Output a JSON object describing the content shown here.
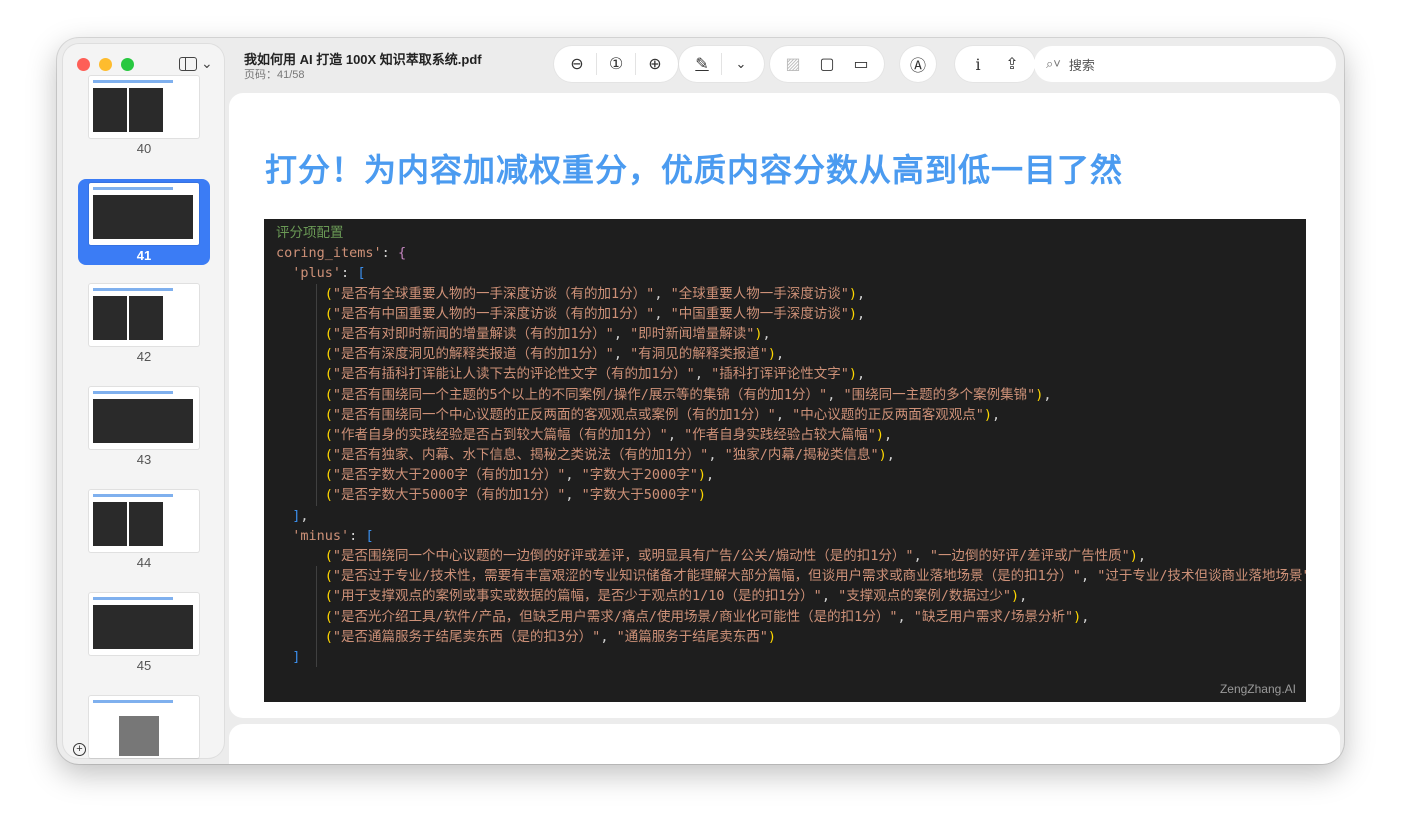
{
  "window": {
    "title": "我如何用 AI 打造 100X 知识萃取系统.pdf",
    "page_indicator": "页码：41/58"
  },
  "toolbar": {
    "search_placeholder": "搜索"
  },
  "sidebar": {
    "thumbnails": [
      {
        "page": "40"
      },
      {
        "page": "41",
        "selected": true
      },
      {
        "page": "42"
      },
      {
        "page": "43"
      },
      {
        "page": "44"
      },
      {
        "page": "45"
      }
    ]
  },
  "document": {
    "heading": "打分！为内容加减权重分，优质内容分数从高到低一目了然",
    "code": {
      "comment": "评分项配置",
      "root_key": "coring_items'",
      "plus_key": "'plus'",
      "minus_key": "'minus'",
      "plus": [
        {
          "a": "\"是否有全球重要人物的一手深度访谈（有的加1分）\"",
          "b": "\"全球重要人物一手深度访谈\"",
          "end": ","
        },
        {
          "a": "\"是否有中国重要人物的一手深度访谈（有的加1分）\"",
          "b": "\"中国重要人物一手深度访谈\"",
          "end": ","
        },
        {
          "a": "\"是否有对即时新闻的增量解读（有的加1分）\"",
          "b": "\"即时新闻增量解读\"",
          "end": ","
        },
        {
          "a": "\"是否有深度洞见的解释类报道（有的加1分）\"",
          "b": "\"有洞见的解释类报道\"",
          "end": ","
        },
        {
          "a": "\"是否有插科打诨能让人读下去的评论性文字（有的加1分）\"",
          "b": "\"插科打诨评论性文字\"",
          "end": ","
        },
        {
          "a": "\"是否有围绕同一个主题的5个以上的不同案例/操作/展示等的集锦（有的加1分）\"",
          "b": "\"围绕同一主题的多个案例集锦\"",
          "end": ","
        },
        {
          "a": "\"是否有围绕同一个中心议题的正反两面的客观观点或案例（有的加1分）\"",
          "b": "\"中心议题的正反两面客观观点\"",
          "end": ","
        },
        {
          "a": "\"作者自身的实践经验是否占到较大篇幅（有的加1分）\"",
          "b": "\"作者自身实践经验占较大篇幅\"",
          "end": ","
        },
        {
          "a": "\"是否有独家、内幕、水下信息、揭秘之类说法（有的加1分）\"",
          "b": "\"独家/内幕/揭秘类信息\"",
          "end": ","
        },
        {
          "a": "\"是否字数大于2000字（有的加1分）\"",
          "b": "\"字数大于2000字\"",
          "end": ","
        },
        {
          "a": "\"是否字数大于5000字（有的加1分）\"",
          "b": "\"字数大于5000字\"",
          "end": ""
        }
      ],
      "minus": [
        {
          "a": "\"是否围绕同一个中心议题的一边倒的好评或差评，或明显具有广告/公关/煽动性（是的扣1分）\"",
          "b": "\"一边倒的好评/差评或广告性质\"",
          "end": ","
        },
        {
          "a": "\"是否过于专业/技术性，需要有丰富艰涩的专业知识储备才能理解大部分篇幅，但谈用户需求或商业落地场景（是的扣1分）\"",
          "b": "\"过于专业/技术但谈商业落地场景\"",
          "end": ","
        },
        {
          "a": "\"用于支撑观点的案例或事实或数据的篇幅，是否少于观点的1/10（是的扣1分）\"",
          "b": "\"支撑观点的案例/数据过少\"",
          "end": ","
        },
        {
          "a": "\"是否光介绍工具/软件/产品，但缺乏用户需求/痛点/使用场景/商业化可能性（是的扣1分）\"",
          "b": "\"缺乏用户需求/场景分析\"",
          "end": ","
        },
        {
          "a": "\"是否通篇服务于结尾卖东西（是的扣3分）\"",
          "b": "\"通篇服务于结尾卖东西\"",
          "end": ""
        }
      ],
      "watermark": "ZengZhang.AI"
    }
  }
}
